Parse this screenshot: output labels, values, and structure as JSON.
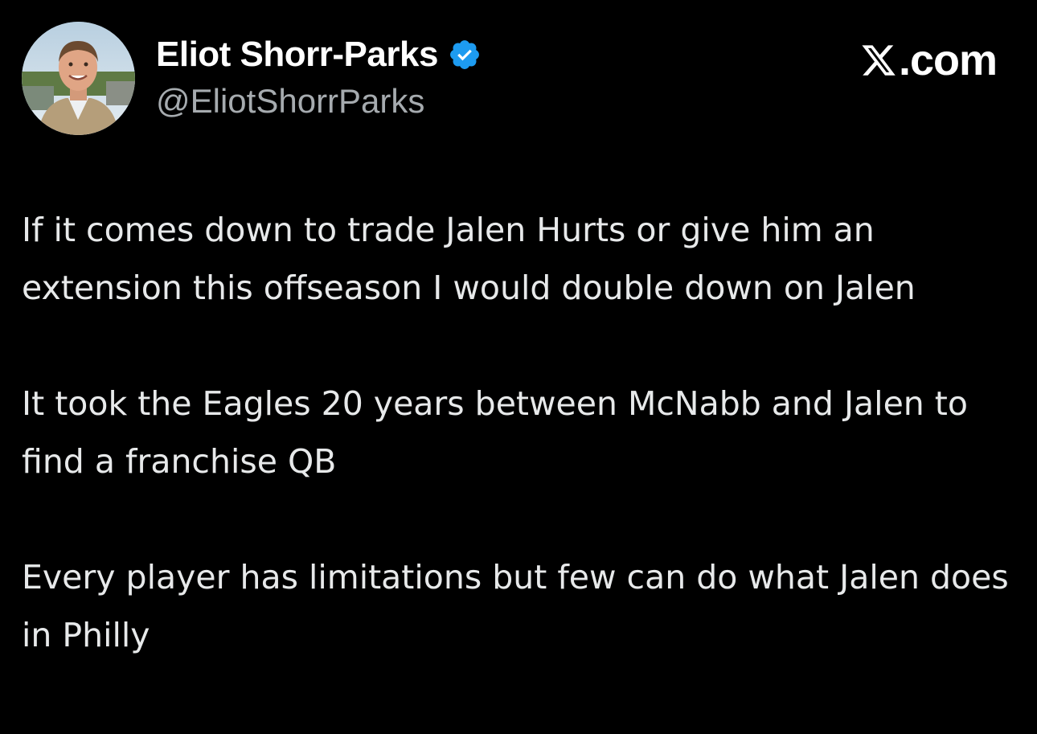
{
  "author": {
    "display_name": "Eliot Shorr-Parks",
    "handle": "@EliotShorrParks",
    "verified": true,
    "verified_badge_color": "#1d9bf0"
  },
  "brand": {
    "logo_icon": "x-logo-icon",
    "suffix": ".com"
  },
  "tweet": {
    "paragraphs": [
      "If it comes down to trade Jalen Hurts or give him an extension this offseason I would double down on Jalen",
      "It took the Eagles 20 years between McNabb and Jalen to find a franchise QB",
      "Every player has limitations but few can do what Jalen does in Philly"
    ]
  },
  "colors": {
    "background": "#000000",
    "text": "#e7e9ea",
    "handle": "#a6abaf"
  }
}
